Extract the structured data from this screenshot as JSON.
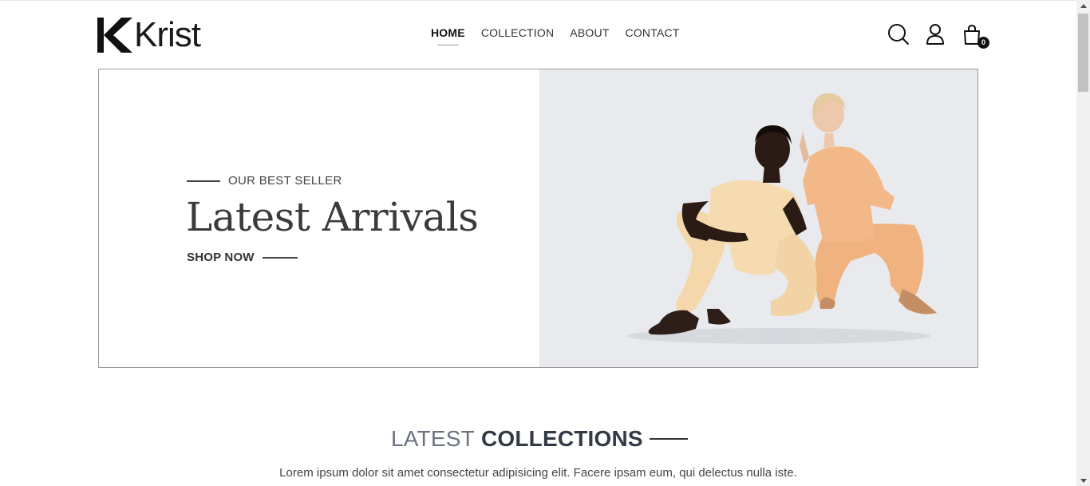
{
  "brand": {
    "name": "Krist"
  },
  "nav": {
    "items": [
      {
        "label": "HOME",
        "active": true
      },
      {
        "label": "COLLECTION",
        "active": false
      },
      {
        "label": "ABOUT",
        "active": false
      },
      {
        "label": "CONTACT",
        "active": false
      }
    ]
  },
  "header_icons": {
    "search": "search-icon",
    "account": "user-icon",
    "cart": "shopping-bag-icon",
    "cart_count": "0"
  },
  "hero": {
    "eyebrow": "OUR BEST SELLER",
    "title": "Latest Arrivals",
    "cta": "SHOP NOW",
    "image": "two-models-in-beige-loungewear"
  },
  "collections": {
    "title_light": "LATEST",
    "title_bold": "COLLECTIONS",
    "description": "Lorem ipsum dolor sit amet consectetur adipisicing elit. Facere ipsam eum, qui delectus nulla iste."
  },
  "colors": {
    "hero_image_bg": "#e8eaed",
    "text_dark": "#333a45",
    "text_muted": "#6b7280"
  }
}
